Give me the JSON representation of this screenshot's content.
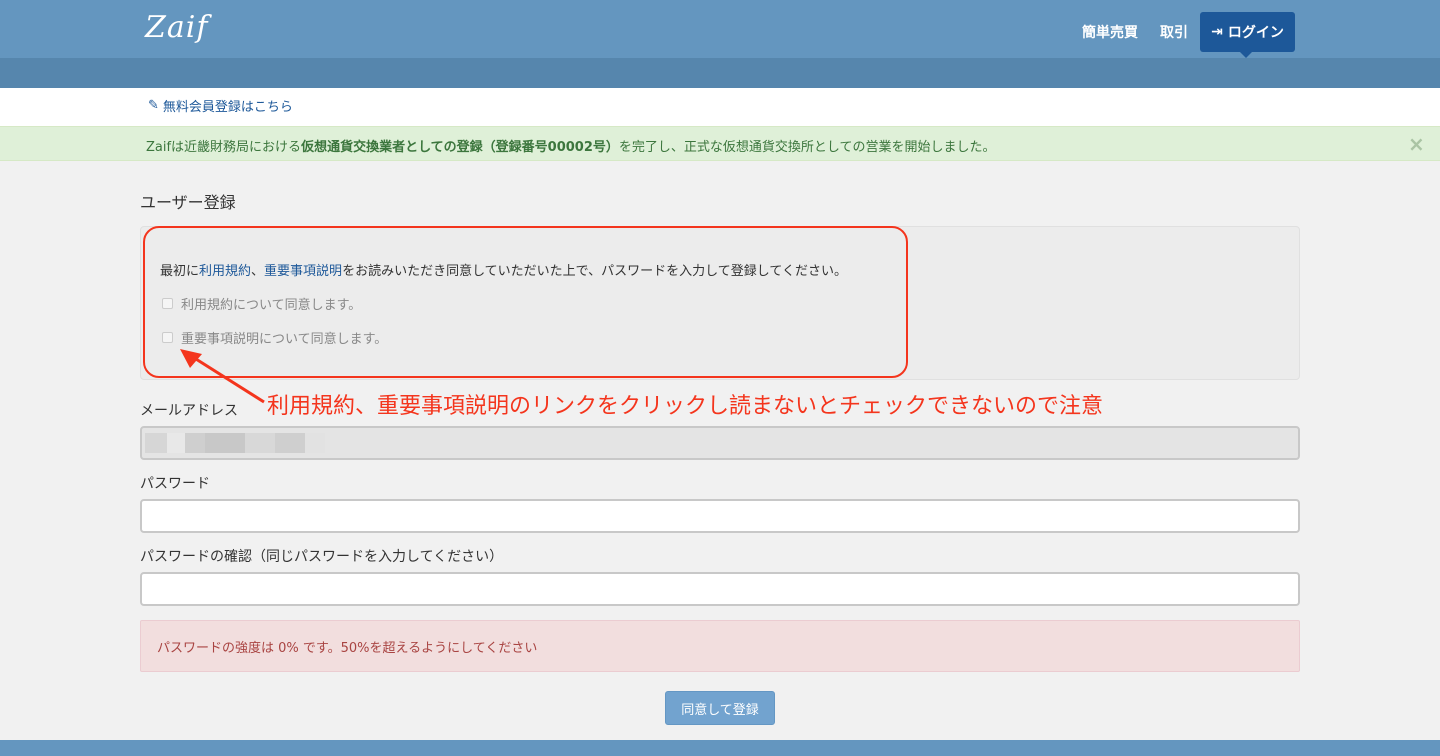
{
  "header": {
    "logo": "Zaif",
    "nav": {
      "market": "簡単売買",
      "trade": "取引",
      "login": "ログイン"
    }
  },
  "register_link": "無料会員登録はこちら",
  "notice": {
    "prefix": "Zaifは近畿財務局における",
    "bold": "仮想通貨交換業者としての登録（登録番号00002号）",
    "suffix": "を完了し、正式な仮想通貨交換所としての営業を開始しました。",
    "close": "×"
  },
  "page_title": "ユーザー登録",
  "agreement": {
    "intro_prefix": "最初に",
    "terms_link": "利用規約",
    "sep": "、",
    "disclosure_link": "重要事項説明",
    "intro_suffix": "をお読みいただき同意していただいた上で、パスワードを入力して登録してください。",
    "check_terms": "利用規約について同意します。",
    "check_disclosure": "重要事項説明について同意します。"
  },
  "annotation": "利用規約、重要事項説明のリンクをクリックし読まないとチェックできないので注意",
  "form": {
    "email_label": "メールアドレス",
    "password_label": "パスワード",
    "password_confirm_label": "パスワードの確認（同じパスワードを入力してください）"
  },
  "alert": "パスワードの強度は 0% です。50%を超えるようにしてください",
  "submit": "同意して登録",
  "colors": {
    "navbar": "#6496bf",
    "login_button": "#1d5899",
    "annotation": "#f4351d",
    "notice_bg": "#dff0d8",
    "alert_bg": "#f2dede"
  }
}
